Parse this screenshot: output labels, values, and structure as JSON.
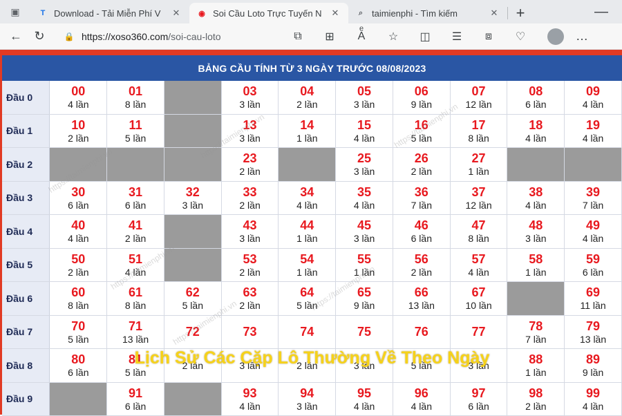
{
  "tabs": [
    {
      "favicon": "T",
      "title": "Download - Tải Miễn Phí V",
      "active": false
    },
    {
      "favicon": "◉",
      "title": "Soi Cầu Loto Trực Tuyến N",
      "active": true
    },
    {
      "favicon": "⌕",
      "title": "taimienphi - Tìm kiếm",
      "active": false
    }
  ],
  "address": {
    "host": "https://xoso360.com",
    "path": "/soi-cau-loto"
  },
  "table": {
    "header": "BẢNG CẦU TÍNH TỪ 3 NGÀY TRƯỚC 08/08/2023",
    "rows": [
      {
        "label": "Đầu 0",
        "cells": [
          {
            "num": "00",
            "count": "4 lần"
          },
          {
            "num": "01",
            "count": "8 lần"
          },
          null,
          {
            "num": "03",
            "count": "3 lần"
          },
          {
            "num": "04",
            "count": "2 lần"
          },
          {
            "num": "05",
            "count": "3 lần"
          },
          {
            "num": "06",
            "count": "9 lần"
          },
          {
            "num": "07",
            "count": "12 lần"
          },
          {
            "num": "08",
            "count": "6 lần"
          },
          {
            "num": "09",
            "count": "4 lần"
          }
        ]
      },
      {
        "label": "Đầu 1",
        "cells": [
          {
            "num": "10",
            "count": "2 lần"
          },
          {
            "num": "11",
            "count": "5 lần"
          },
          null,
          {
            "num": "13",
            "count": "3 lần"
          },
          {
            "num": "14",
            "count": "1 lần"
          },
          {
            "num": "15",
            "count": "4 lần"
          },
          {
            "num": "16",
            "count": "5 lần"
          },
          {
            "num": "17",
            "count": "8 lần"
          },
          {
            "num": "18",
            "count": "4 lần"
          },
          {
            "num": "19",
            "count": "4 lần"
          }
        ]
      },
      {
        "label": "Đầu 2",
        "cells": [
          null,
          null,
          null,
          {
            "num": "23",
            "count": "2 lần"
          },
          null,
          {
            "num": "25",
            "count": "3 lần"
          },
          {
            "num": "26",
            "count": "2 lần"
          },
          {
            "num": "27",
            "count": "1 lần"
          },
          null,
          null
        ]
      },
      {
        "label": "Đầu 3",
        "cells": [
          {
            "num": "30",
            "count": "6 lần"
          },
          {
            "num": "31",
            "count": "6 lần"
          },
          {
            "num": "32",
            "count": "3 lần"
          },
          {
            "num": "33",
            "count": "2 lần"
          },
          {
            "num": "34",
            "count": "4 lần"
          },
          {
            "num": "35",
            "count": "4 lần"
          },
          {
            "num": "36",
            "count": "7 lần"
          },
          {
            "num": "37",
            "count": "12 lần"
          },
          {
            "num": "38",
            "count": "4 lần"
          },
          {
            "num": "39",
            "count": "7 lần"
          }
        ]
      },
      {
        "label": "Đầu 4",
        "cells": [
          {
            "num": "40",
            "count": "4 lần"
          },
          {
            "num": "41",
            "count": "2 lần"
          },
          null,
          {
            "num": "43",
            "count": "3 lần"
          },
          {
            "num": "44",
            "count": "1 lần"
          },
          {
            "num": "45",
            "count": "3 lần"
          },
          {
            "num": "46",
            "count": "6 lần"
          },
          {
            "num": "47",
            "count": "8 lần"
          },
          {
            "num": "48",
            "count": "3 lần"
          },
          {
            "num": "49",
            "count": "4 lần"
          }
        ]
      },
      {
        "label": "Đầu 5",
        "cells": [
          {
            "num": "50",
            "count": "2 lần"
          },
          {
            "num": "51",
            "count": "4 lần"
          },
          null,
          {
            "num": "53",
            "count": "2 lần"
          },
          {
            "num": "54",
            "count": "1 lần"
          },
          {
            "num": "55",
            "count": "1 lần"
          },
          {
            "num": "56",
            "count": "2 lần"
          },
          {
            "num": "57",
            "count": "4 lần"
          },
          {
            "num": "58",
            "count": "1 lần"
          },
          {
            "num": "59",
            "count": "6 lần"
          }
        ]
      },
      {
        "label": "Đầu 6",
        "cells": [
          {
            "num": "60",
            "count": "8 lần"
          },
          {
            "num": "61",
            "count": "8 lần"
          },
          {
            "num": "62",
            "count": "5 lần"
          },
          {
            "num": "63",
            "count": "2 lần"
          },
          {
            "num": "64",
            "count": "5 lần"
          },
          {
            "num": "65",
            "count": "9 lần"
          },
          {
            "num": "66",
            "count": "13 lần"
          },
          {
            "num": "67",
            "count": "10 lần"
          },
          null,
          {
            "num": "69",
            "count": "11 lần"
          }
        ]
      },
      {
        "label": "Đầu 7",
        "cells": [
          {
            "num": "70",
            "count": "5 lần"
          },
          {
            "num": "71",
            "count": "13 lần"
          },
          {
            "num": "72",
            "count": ""
          },
          {
            "num": "73",
            "count": ""
          },
          {
            "num": "74",
            "count": ""
          },
          {
            "num": "75",
            "count": ""
          },
          {
            "num": "76",
            "count": ""
          },
          {
            "num": "77",
            "count": ""
          },
          {
            "num": "78",
            "count": "7 lần"
          },
          {
            "num": "79",
            "count": "13 lần"
          }
        ]
      },
      {
        "label": "Đầu 8",
        "cells": [
          {
            "num": "80",
            "count": "6 lần"
          },
          {
            "num": "81",
            "count": "5 lần"
          },
          {
            "num": "",
            "count": "2 lần"
          },
          {
            "num": "",
            "count": "3 lần"
          },
          {
            "num": "",
            "count": "2 lần"
          },
          {
            "num": "",
            "count": "3 lần"
          },
          {
            "num": "",
            "count": "5 lần"
          },
          {
            "num": "",
            "count": "3 lần"
          },
          {
            "num": "88",
            "count": "1 lần"
          },
          {
            "num": "89",
            "count": "9 lần"
          }
        ]
      },
      {
        "label": "Đầu 9",
        "cells": [
          null,
          {
            "num": "91",
            "count": "6 lần"
          },
          null,
          {
            "num": "93",
            "count": "4 lần"
          },
          {
            "num": "94",
            "count": "3 lần"
          },
          {
            "num": "95",
            "count": "4 lần"
          },
          {
            "num": "96",
            "count": "4 lần"
          },
          {
            "num": "97",
            "count": "6 lần"
          },
          {
            "num": "98",
            "count": "2 lần"
          },
          {
            "num": "99",
            "count": "4 lần"
          }
        ]
      }
    ]
  },
  "overlay_caption": "Lịch Sử Các Cặp Lô Thường Về Theo Ngày",
  "watermark_text": "https://taimienphi.vn"
}
